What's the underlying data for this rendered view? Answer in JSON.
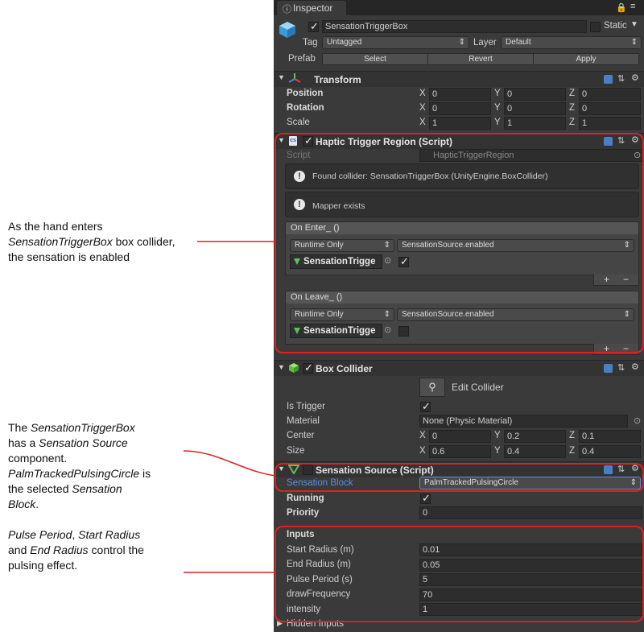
{
  "annotations": {
    "note1": {
      "l1": "As the hand enters",
      "l2_italic": "SensationTriggerBox",
      "l2_rest": " box collider,",
      "l3": "the sensation is enabled"
    },
    "note2": {
      "l1_a": "The ",
      "l1_italic": "SensationTriggerBox",
      "l2_a": "has a ",
      "l2_italic": "Sensation Source",
      "l3": "component.",
      "l4_italic": "PalmTrackedPulsingCircle",
      "l4_rest": " is",
      "l5_a": "the selected ",
      "l5_italic": "Sensation",
      "l6_italic": "Block",
      "l6_rest": "."
    },
    "note3": {
      "l1_italic_a": "Pulse Period",
      "l1_mid": ", ",
      "l1_italic_b": "Start Radius",
      "l2_a": "and ",
      "l2_italic": "End Radius",
      "l2_rest": " control the",
      "l3": "pulsing effect."
    }
  },
  "inspector": {
    "tab_label": "Inspector",
    "object_name": "SensationTriggerBox",
    "static_label": "Static",
    "tag_label": "Tag",
    "tag_value": "Untagged",
    "layer_label": "Layer",
    "layer_value": "Default",
    "prefab_label": "Prefab",
    "prefab_select": "Select",
    "prefab_revert": "Revert",
    "prefab_apply": "Apply"
  },
  "transform": {
    "title": "Transform",
    "rows": [
      {
        "label": "Position",
        "x": "0",
        "y": "0",
        "z": "0"
      },
      {
        "label": "Rotation",
        "x": "0",
        "y": "0",
        "z": "0"
      },
      {
        "label": "Scale",
        "x": "1",
        "y": "1",
        "z": "1"
      }
    ],
    "axis": {
      "x": "X",
      "y": "Y",
      "z": "Z"
    }
  },
  "haptic": {
    "title": "Haptic Trigger Region (Script)",
    "script_label": "Script",
    "script_value": "HapticTriggerRegion",
    "info1": "Found collider: SensationTriggerBox (UnityEngine.BoxCollider)",
    "info2": "Mapper exists",
    "on_enter": "On Enter_ ()",
    "on_leave": "On Leave_ ()",
    "runtime_only": "Runtime Only",
    "function": "SensationSource.enabled",
    "object_ref": "SensationTrigge",
    "plus": "+",
    "minus": "−"
  },
  "box_collider": {
    "title": "Box Collider",
    "edit_collider": "Edit Collider",
    "is_trigger_label": "Is Trigger",
    "material_label": "Material",
    "material_value": "None (Physic Material)",
    "center_label": "Center",
    "center": {
      "x": "0",
      "y": "0.2",
      "z": "0.1"
    },
    "size_label": "Size",
    "size": {
      "x": "0.6",
      "y": "0.4",
      "z": "0.4"
    }
  },
  "sensation_source": {
    "title": "Sensation Source (Script)",
    "block_label": "Sensation Block",
    "block_value": "PalmTrackedPulsingCircle",
    "running_label": "Running",
    "priority_label": "Priority",
    "priority_value": "0",
    "inputs_label": "Inputs",
    "inputs": [
      {
        "label": "Start Radius (m)",
        "value": "0.01"
      },
      {
        "label": "End Radius (m)",
        "value": "0.05"
      },
      {
        "label": "Pulse Period (s)",
        "value": "5"
      },
      {
        "label": "drawFrequency",
        "value": "70"
      },
      {
        "label": "intensity",
        "value": "1"
      }
    ],
    "hidden_inputs": "Hidden Inputs"
  },
  "colors": {
    "highlight": "#e02020",
    "link_blue": "#5a8fe0",
    "panel": "#3a3a3a"
  }
}
